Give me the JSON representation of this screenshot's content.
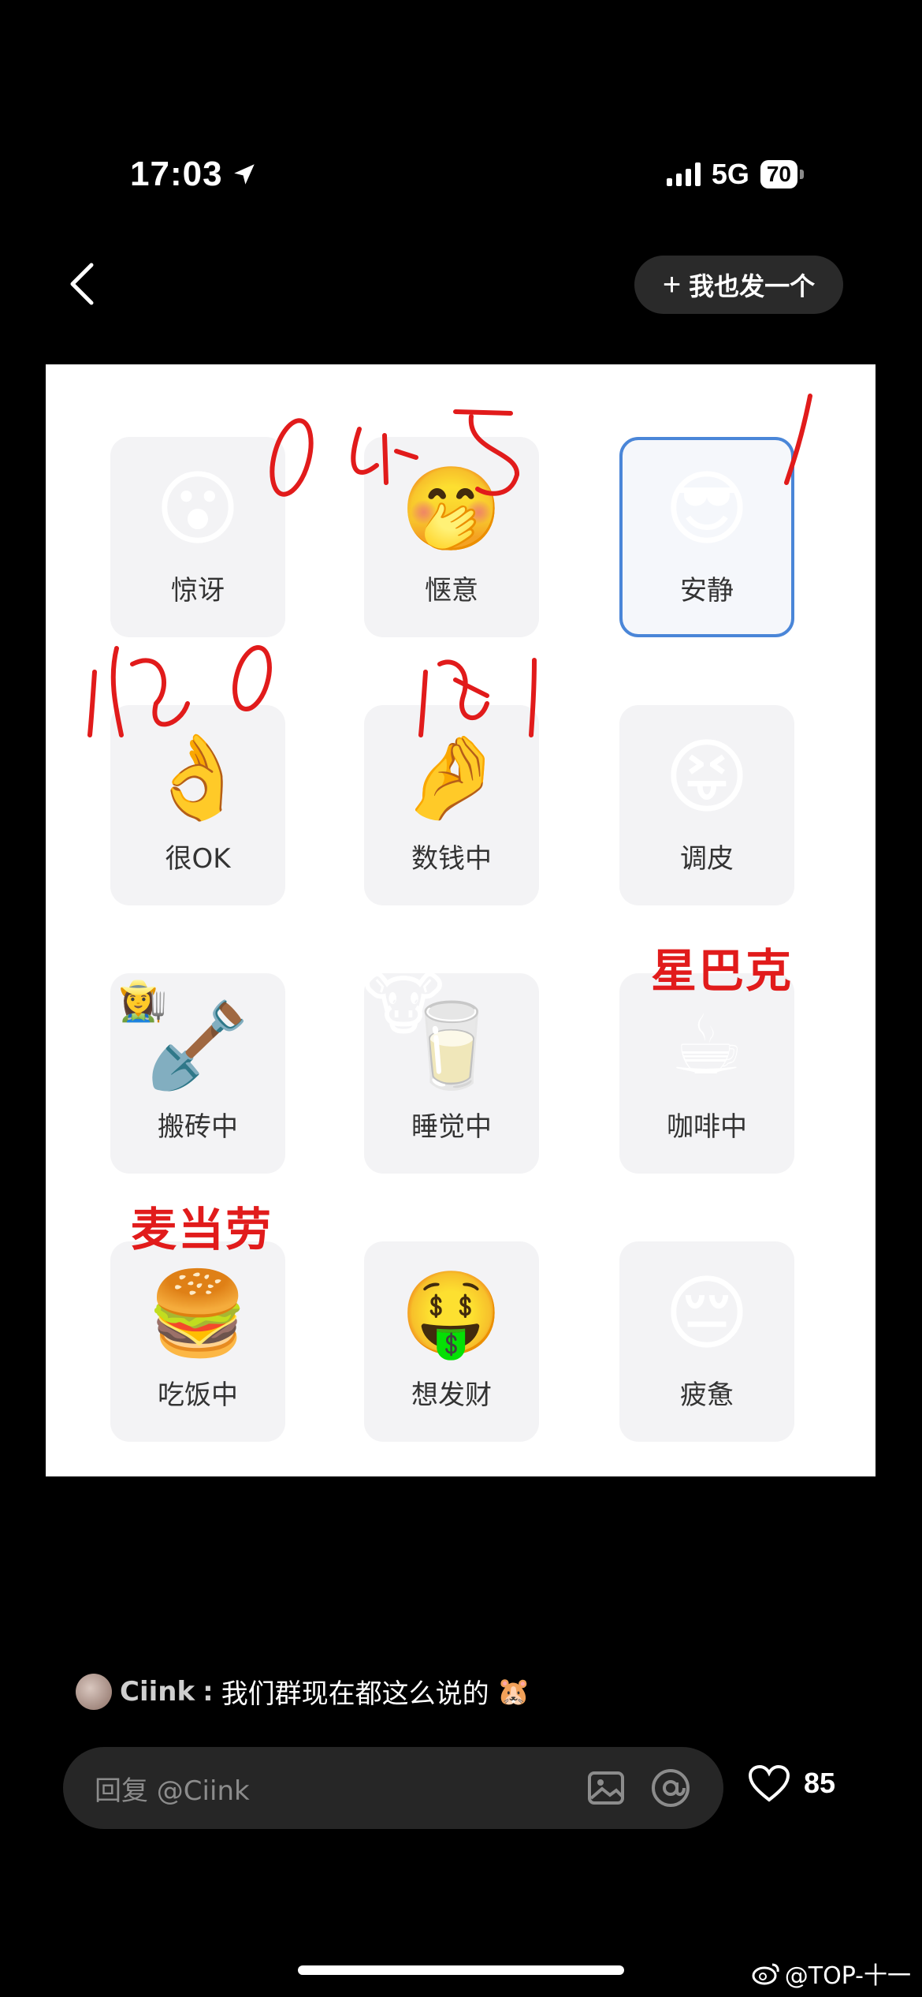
{
  "status_bar": {
    "time": "17:03",
    "network": "5G",
    "battery": "70"
  },
  "nav": {
    "post_button": "我也发一个",
    "post_plus": "+"
  },
  "tiles": [
    {
      "emoji": "😮",
      "label": "惊讶"
    },
    {
      "emoji": "🤭",
      "label": "惬意"
    },
    {
      "emoji": "😎",
      "label": "安静",
      "selected": true
    },
    {
      "emoji": "👌",
      "label": "很OK"
    },
    {
      "emoji": "🤌",
      "label": "数钱中"
    },
    {
      "emoji": "😝",
      "label": "调皮"
    },
    {
      "emoji": "🪏",
      "label": "搬砖中"
    },
    {
      "emoji": "🥛",
      "label": "睡觉中"
    },
    {
      "emoji": "☕",
      "label": "咖啡中"
    },
    {
      "emoji": "🍔",
      "label": "吃饭中"
    },
    {
      "emoji": "🤑",
      "label": "想发财"
    },
    {
      "emoji": "😔",
      "label": "疲惫"
    }
  ],
  "tile_extras": {
    "farmer": "👩‍🌾",
    "cow": "🐮"
  },
  "annotations": {
    "starbucks": "星巴克",
    "mcdonalds": "麦当劳"
  },
  "comment": {
    "user": "Ciink",
    "separator": ":",
    "text": "我们群现在都这么说的",
    "emoji": "🐹"
  },
  "reply": {
    "placeholder": "回复 @Ciink"
  },
  "likes": {
    "count": "85"
  },
  "watermark": {
    "text": "@TOP-十一"
  }
}
